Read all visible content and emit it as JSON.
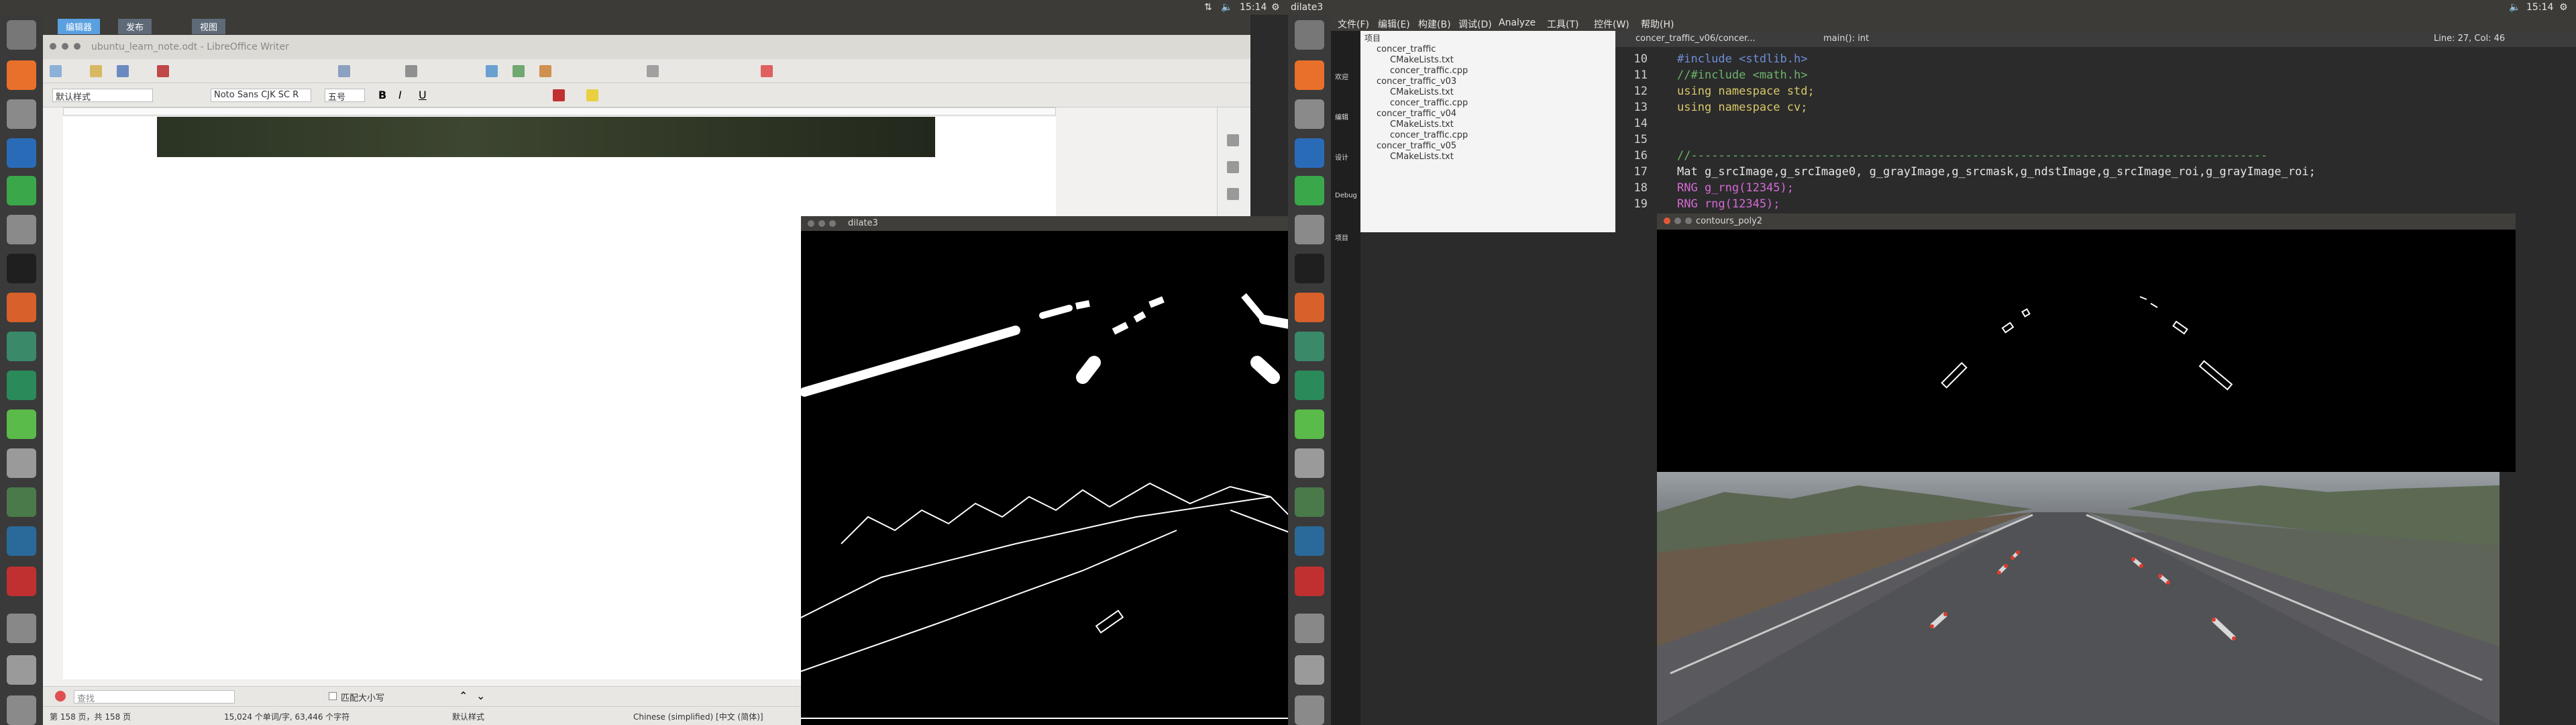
{
  "left_screen": {
    "clock": "15:14",
    "window_title": "dilate3",
    "tabs": [
      "编辑器",
      "发布",
      "视图"
    ],
    "writer": {
      "title": "ubuntu_learn_note.odt - LibreOffice Writer",
      "style_value": "默认样式",
      "font_value": "Noto Sans CJK SC R",
      "size_value": "五号",
      "find_placeholder": "查找",
      "match_case": "匹配大小写",
      "status_page": "第 158 页，共 158 页",
      "status_words": "15,024 个单词/字, 63,446 个字符",
      "status_style": "默认样式",
      "status_lang": "Chinese (simplified) [中文 (简体)]"
    },
    "dilate_window_title": "dilate3"
  },
  "right_screen": {
    "clock": "15:14",
    "window_title": "dilate3",
    "menus": [
      "文件(F)",
      "编辑(E)",
      "构建(B)",
      "调试(D)",
      "Analyze",
      "工具(T)",
      "控件(W)",
      "帮助(H)"
    ],
    "tab_file": "concer_traffic_v06/concer...",
    "tab_function": "main(): int",
    "tab_position": "Line: 27, Col: 46",
    "sidebar_modes": [
      "欢迎",
      "编辑",
      "设计",
      "Debug",
      "项目"
    ],
    "project_label": "项目",
    "tree": [
      {
        "label": "concer_traffic",
        "indent": 0
      },
      {
        "label": "CMakeLists.txt",
        "indent": 1
      },
      {
        "label": "concer_traffic.cpp",
        "indent": 1
      },
      {
        "label": "concer_traffic_v03",
        "indent": 0
      },
      {
        "label": "CMakeLists.txt",
        "indent": 1
      },
      {
        "label": "concer_traffic.cpp",
        "indent": 1
      },
      {
        "label": "concer_traffic_v04",
        "indent": 0
      },
      {
        "label": "CMakeLists.txt",
        "indent": 1
      },
      {
        "label": "concer_traffic.cpp",
        "indent": 1
      },
      {
        "label": "concer_traffic_v05",
        "indent": 0
      },
      {
        "label": "CMakeLists.txt",
        "indent": 1
      }
    ],
    "code_lines": [
      {
        "num": "10",
        "text": "#include <stdlib.h>"
      },
      {
        "num": "11",
        "text": "//#include <math.h>"
      },
      {
        "num": "12",
        "text": "using namespace std;"
      },
      {
        "num": "13",
        "text": "using namespace cv;"
      },
      {
        "num": "14",
        "text": ""
      },
      {
        "num": "15",
        "text": ""
      },
      {
        "num": "16",
        "text": "//------------------------------------------------------------------------------------"
      },
      {
        "num": "17",
        "text": "Mat g_srcImage,g_srcImage0, g_grayImage,g_srcmask,g_ndstImage,g_srcImage_roi,g_grayImage_roi;"
      },
      {
        "num": "18",
        "text": "RNG g_rng(12345);"
      },
      {
        "num": "19",
        "text": "RNG rng(12345);"
      }
    ],
    "contours_window_title": "contours_poly2"
  },
  "colors": {
    "launcher_bg": "#3a3a3a",
    "topbar_bg": "#3c3b37",
    "editor_bg": "#2b2b2b",
    "accent_red": "#e05a3a",
    "keyword_blue": "#6f8fd8",
    "string_yellow": "#d8c86a",
    "comment_green": "#6cb36c",
    "type_magenta": "#d66ad6"
  },
  "icons": [
    "dash-icon",
    "firefox-icon",
    "files-icon",
    "writer-icon",
    "calc-icon",
    "settings-icon",
    "terminal-icon",
    "matlab-icon",
    "gitkraken-icon",
    "pycharm-icon",
    "qt-icon",
    "disk-icon",
    "screenshot-icon",
    "clion-icon",
    "xmind-icon",
    "help-icon",
    "drive-icon",
    "trash-icon"
  ]
}
